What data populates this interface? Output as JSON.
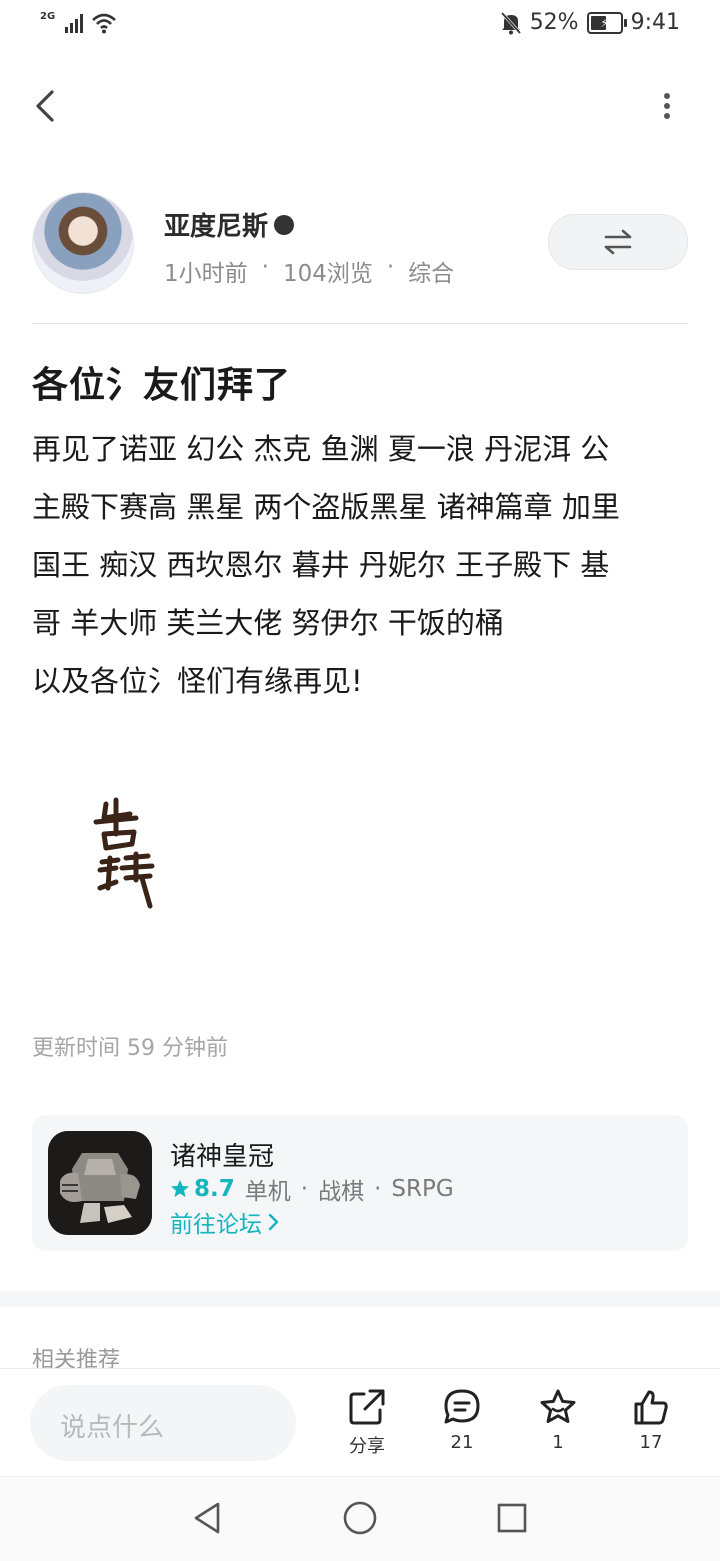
{
  "status_bar": {
    "network": "2G",
    "battery_percent": "52%",
    "battery_level": 0.52,
    "time": "9:41",
    "icons": [
      "signal-icon",
      "wifi-icon",
      "mute-bell-icon",
      "battery-charging-icon"
    ]
  },
  "author": {
    "name": "亚度尼斯",
    "time_ago": "1小时前",
    "views": "104浏览",
    "category": "综合"
  },
  "post": {
    "title": "各位氵友们拜了",
    "lines": [
      "再见了诺亚 幻公 杰克 鱼渊 夏一浪 丹泥洱 公",
      "主殿下赛高 黑星 两个盗版黑星 诸神篇章 加里",
      "国王 痴汉 西坎恩尔 暮井 丹妮尔 王子殿下 基",
      "哥 羊大师 芙兰大佬 努伊尔 干饭的桶",
      "以及各位氵怪们有缘再见!"
    ],
    "update_time": "更新时间 59 分钟前"
  },
  "game": {
    "name": "诸神皇冠",
    "rating": "8.7",
    "tags": [
      "单机",
      "战棋",
      "SRPG"
    ],
    "forum_link": "前往论坛"
  },
  "related_title": "相关推荐",
  "bottom_bar": {
    "comment_placeholder": "说点什么",
    "share_label": "分享",
    "comment_count": "21",
    "favorite_count": "1",
    "like_count": "17"
  },
  "colors": {
    "accent": "#15b5c0",
    "text": "#1a1a1a",
    "muted": "#8c8c8c"
  }
}
